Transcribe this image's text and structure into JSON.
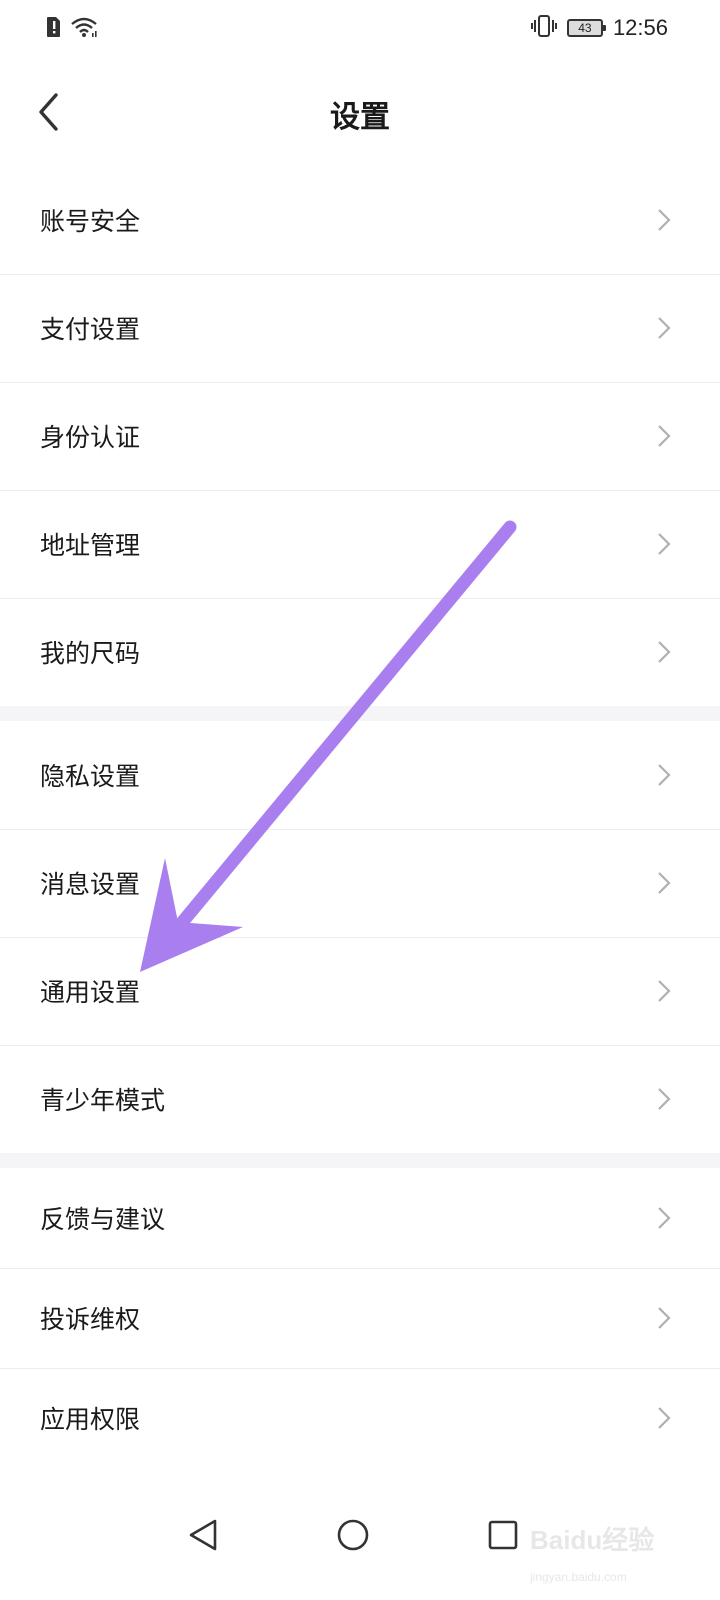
{
  "status_bar": {
    "time": "12:56",
    "battery": "43",
    "icons": [
      "alert-icon",
      "wifi-icon",
      "vibrate-icon",
      "battery-icon"
    ]
  },
  "header": {
    "title": "设置",
    "back_icon": "back-arrow-icon"
  },
  "menu": {
    "groups": [
      {
        "items": [
          {
            "label": "账号安全"
          },
          {
            "label": "支付设置"
          },
          {
            "label": "身份认证"
          },
          {
            "label": "地址管理"
          },
          {
            "label": "我的尺码"
          }
        ]
      },
      {
        "items": [
          {
            "label": "隐私设置"
          },
          {
            "label": "消息设置"
          },
          {
            "label": "通用设置"
          },
          {
            "label": "青少年模式"
          }
        ]
      },
      {
        "items": [
          {
            "label": "反馈与建议"
          },
          {
            "label": "投诉维权"
          },
          {
            "label": "应用权限"
          }
        ]
      }
    ]
  },
  "annotation": {
    "arrow_color": "#a97ff0",
    "target": "通用设置"
  },
  "nav_bar": {
    "icons": [
      "back-triangle-icon",
      "home-circle-icon",
      "recents-square-icon"
    ]
  },
  "watermark": {
    "text": "Baidu经验",
    "sub": "jingyan.baidu.com"
  }
}
